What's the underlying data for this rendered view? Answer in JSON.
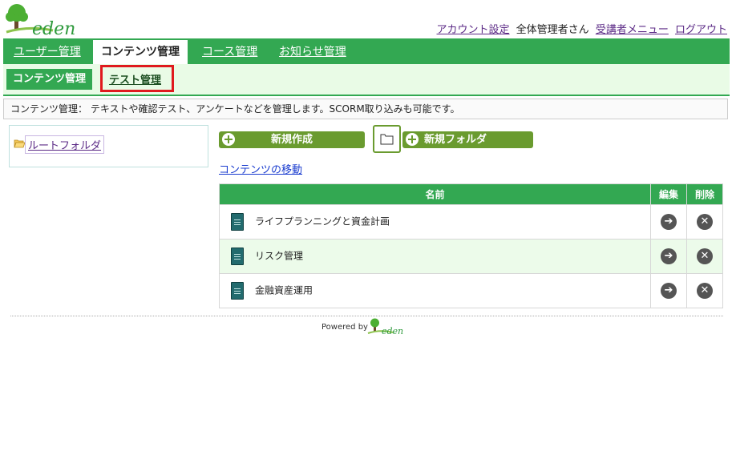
{
  "logo": {
    "text": "eden"
  },
  "toplinks": {
    "account": "アカウント設定",
    "user": "全体管理者さん",
    "learner_menu": "受講者メニュー",
    "logout": "ログアウト"
  },
  "mainnav": {
    "tabs": [
      "ユーザー管理",
      "コンテンツ管理",
      "コース管理",
      "お知らせ管理"
    ]
  },
  "subnav": {
    "tab1": "コンテンツ管理",
    "tab2": "テスト管理"
  },
  "description": "コンテンツ管理： テキストや確認テスト、アンケートなどを管理します。SCORM取り込みも可能です。",
  "tree": {
    "root": "ルートフォルダ"
  },
  "buttons": {
    "new": "新規作成",
    "new_folder": "新規フォルダ",
    "move": "コンテンツの移動"
  },
  "table": {
    "headers": {
      "name": "名前",
      "edit": "編集",
      "delete": "削除"
    },
    "rows": [
      {
        "name": "ライフプランニングと資金計画"
      },
      {
        "name": "リスク管理"
      },
      {
        "name": "金融資産運用"
      }
    ]
  },
  "footer": {
    "powered": "Powered by"
  },
  "colors": {
    "green": "#33a852",
    "button_green": "#6a9b2f",
    "highlight_red": "#e0191e"
  }
}
